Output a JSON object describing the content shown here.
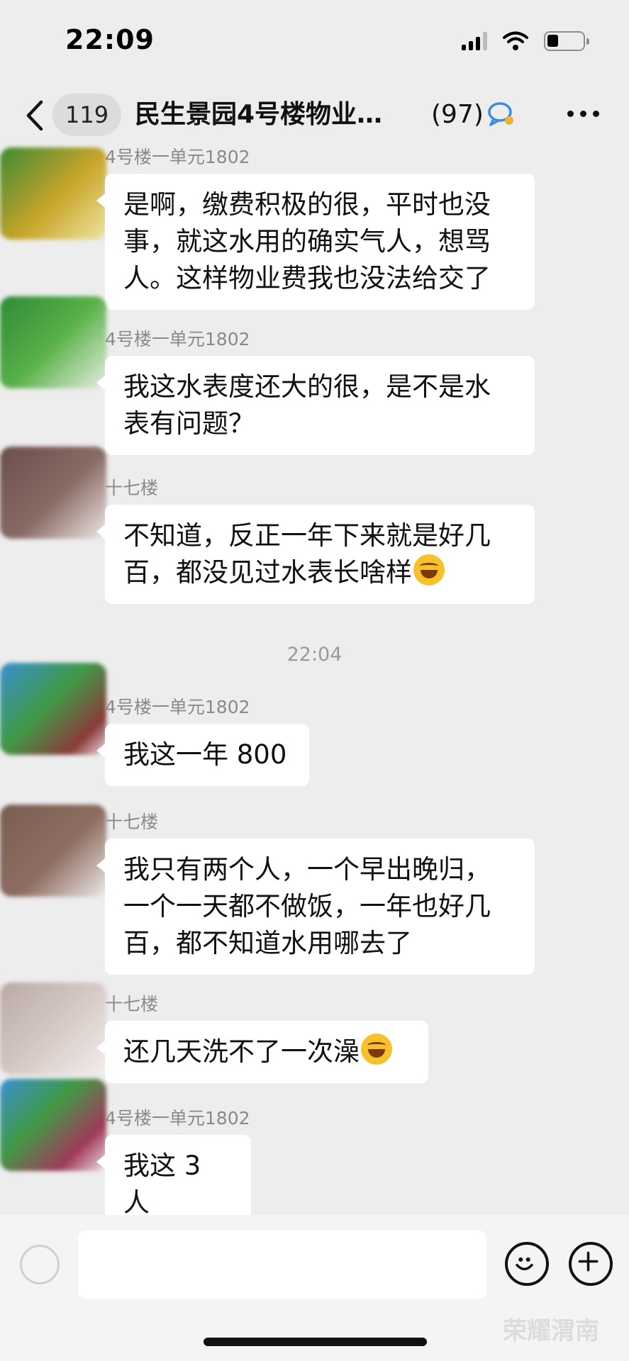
{
  "status_bar": {
    "time": "22:09"
  },
  "nav": {
    "unread_count": "119",
    "title": "民生景园4号楼物业…",
    "member_count": "(97)"
  },
  "messages": [
    {
      "sender": "4号楼一单元1802",
      "text": "是啊，缴费积极的很，平时也没事，就这水用的确实气人，想骂人。这样物业费我也没法给交了"
    },
    {
      "sender": "4号楼一单元1802",
      "text": "我这水表度还大的很，是不是水表有问题？"
    },
    {
      "sender": "十七楼",
      "text": "不知道，反正一年下来就是好几百，都没见过水表长啥样",
      "emoji": "rolling-laughing-emoji"
    },
    {
      "sender": "4号楼一单元1802",
      "text": "我这一年 800"
    },
    {
      "sender": "十七楼",
      "text": "我只有两个人，一个早出晚归，一个一天都不做饭，一年也好几百，都不知道水用哪去了"
    },
    {
      "sender": "十七楼",
      "text": "还几天洗不了一次澡",
      "emoji": "tears-of-joy-emoji"
    },
    {
      "sender": "4号楼一单元1802",
      "text": "我这 3 人"
    }
  ],
  "timestamp": "22:04",
  "input": {
    "value": ""
  },
  "watermark": "荣耀渭南",
  "colors": {
    "background": "#ededed",
    "bubble": "#ffffff",
    "sender_text": "#8a8a8a"
  }
}
